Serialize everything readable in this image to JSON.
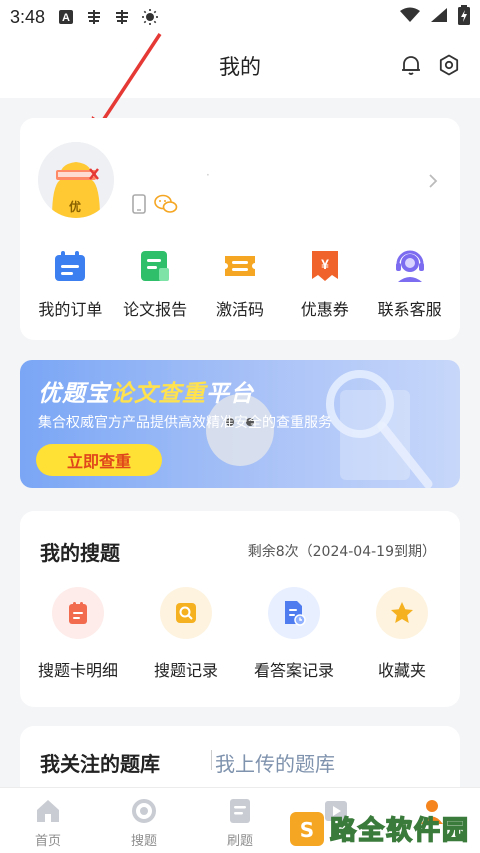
{
  "statusbar": {
    "time": "3:48",
    "icons": [
      "font-a-icon",
      "bug-icon",
      "bug-icon",
      "brightness-icon",
      "wifi-icon",
      "signal-icon",
      "battery-charging-icon"
    ]
  },
  "header": {
    "title": "我的",
    "icons": [
      "bell-icon",
      "gear-icon"
    ]
  },
  "profile": {
    "username": "·",
    "avatar_badge": "优",
    "shortcuts": [
      {
        "label": "我的订单",
        "icon": "order-icon",
        "color": "#3b7ff0"
      },
      {
        "label": "论文报告",
        "icon": "report-icon",
        "color": "#2fbf6b"
      },
      {
        "label": "激活码",
        "icon": "ticket-icon",
        "color": "#f5a623"
      },
      {
        "label": "优惠券",
        "icon": "coupon-icon",
        "color": "#f0642b"
      },
      {
        "label": "联系客服",
        "icon": "headset-icon",
        "color": "#7b6cf0"
      }
    ]
  },
  "banner": {
    "title_part1": "优题宝",
    "title_part2": "论文查重",
    "title_part3": "平台",
    "subtitle": "集合权威官方产品提供高效精准安全的查重服务",
    "button": "立即查重"
  },
  "my_search": {
    "title": "我的搜题",
    "remaining": "剩余8次（2024-04-19到期）",
    "items": [
      {
        "label": "搜题卡明细",
        "icon": "search-card-icon",
        "color": "#f26b4f",
        "bg": "#fdecea"
      },
      {
        "label": "搜题记录",
        "icon": "search-record-icon",
        "color": "#f5b120",
        "bg": "#fdf3df"
      },
      {
        "label": "看答案记录",
        "icon": "answer-record-icon",
        "color": "#4f7df0",
        "bg": "#e8efff"
      },
      {
        "label": "收藏夹",
        "icon": "star-icon",
        "color": "#f5b120",
        "bg": "#fdf3df"
      }
    ]
  },
  "question_bank": {
    "tab_followed": "我关注的题库",
    "tab_uploaded": "我上传的题库"
  },
  "tabbar": {
    "tabs": [
      {
        "label": "首页",
        "icon": "home-icon"
      },
      {
        "label": "搜题",
        "icon": "search-tab-icon"
      },
      {
        "label": "刷题",
        "icon": "practice-icon"
      },
      {
        "label": "",
        "icon": "video-icon"
      },
      {
        "label": "",
        "icon": "profile-tab-icon"
      }
    ]
  },
  "watermark": {
    "text": "路全软件园"
  }
}
